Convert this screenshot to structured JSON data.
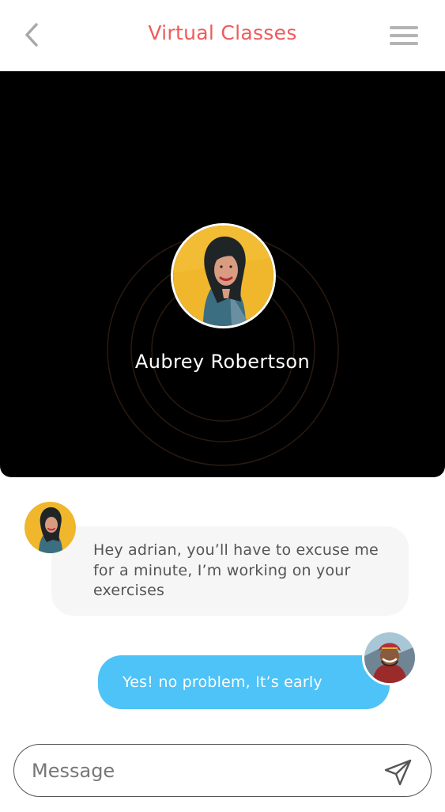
{
  "header": {
    "title": "Virtual Classes",
    "back_icon": "chevron-left-icon",
    "menu_icon": "hamburger-menu-icon",
    "title_color": "#f05a5b"
  },
  "call": {
    "caller_name": "Aubrey Robertson",
    "background_color": "#000000"
  },
  "messages": [
    {
      "sender": "Aubrey Robertson",
      "direction": "incoming",
      "text": "Hey adrian, you’ll have to excuse me for a minute, I’m working on your exercises"
    },
    {
      "sender": "adrian",
      "direction": "outgoing",
      "text": "Yes! no problem, It’s early",
      "bubble_color": "#4ec3f7"
    }
  ],
  "composer": {
    "placeholder": "Message",
    "value": "",
    "send_icon": "paper-plane-send-icon"
  }
}
